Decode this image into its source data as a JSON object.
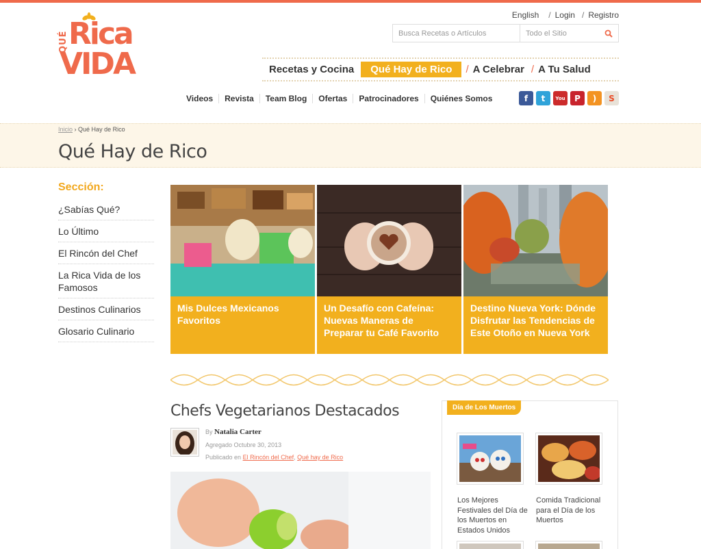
{
  "brand": {
    "logo_que": "QUÉ",
    "logo_rica": "Rica",
    "logo_vida": "VIDA",
    "color": "#ef6a4b",
    "accent": "#f2b01e"
  },
  "top_links": {
    "lang": "English",
    "login": "Login",
    "register": "Registro",
    "sep": "/"
  },
  "search": {
    "placeholder": "Busca Recetas o Artículos",
    "scope": "Todo el Sitio"
  },
  "main_nav": [
    "Recetas y Cocina",
    "Qué Hay de Rico",
    "A Celebrar",
    "A Tu Salud"
  ],
  "sub_nav": [
    "Videos",
    "Revista",
    "Team Blog",
    "Ofertas",
    "Patrocinadores",
    "Quiénes Somos"
  ],
  "social": [
    "facebook-icon",
    "twitter-icon",
    "youtube-icon",
    "pinterest-icon",
    "rss-icon",
    "stumbleupon-icon"
  ],
  "breadcrumb": {
    "home": "Inicio",
    "sep": "›",
    "current": "Qué Hay de Rico"
  },
  "page_title": "Qué Hay de Rico",
  "sidebar": {
    "heading": "Sección:",
    "items": [
      "¿Sabías Qué?",
      "Lo Último",
      "El Rincón del Chef",
      "La Rica Vida de los Famosos",
      "Destinos Culinarios",
      "Glosario Culinario"
    ]
  },
  "features": [
    {
      "caption": "Mis Dulces Mexicanos Favoritos"
    },
    {
      "caption": "Un Desafío con Cafeína: Nuevas Maneras de Preparar tu Café Favorito"
    },
    {
      "caption": "Destino Nueva York: Dónde Disfrutar las Tendencias de Este Otoño en Nueva York"
    }
  ],
  "article": {
    "title": "Chefs Vegetarianos Destacados",
    "by": "By",
    "author": "Natalia Carter",
    "date": "Agregado Octubre 30, 2013",
    "published_in": "Publicado en",
    "cat1": "El Rincón del Chef",
    "comma": ",",
    "cat2": "Qué hay de Rico"
  },
  "right_box": {
    "tab": "Día de Los Muertos",
    "items": [
      {
        "caption": "Los Mejores Festivales del Día de los Muertos en Estados Unidos"
      },
      {
        "caption": "Comida Tradicional para el Día de los Muertos"
      }
    ]
  }
}
